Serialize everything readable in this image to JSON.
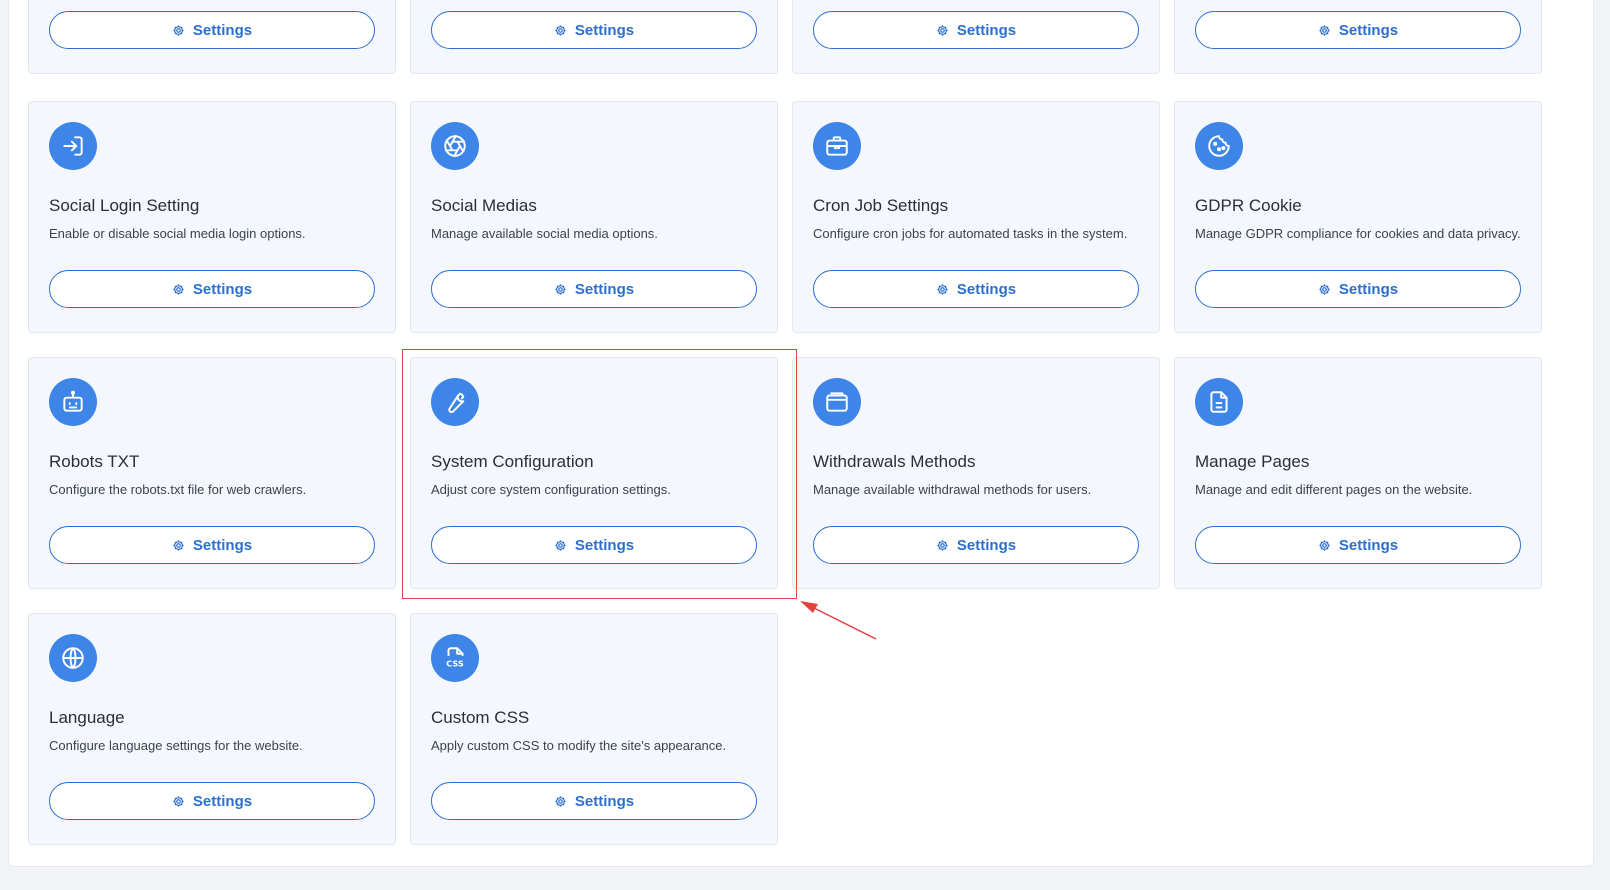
{
  "settings_label": "Settings",
  "colors": {
    "accent": "#3d85e6",
    "button": "#2d6fcf",
    "highlight": "#e5423f"
  },
  "cards": [
    {
      "title": "",
      "description": "",
      "icon": "none"
    },
    {
      "title": "",
      "description": "",
      "icon": "none"
    },
    {
      "title": "",
      "description": "",
      "icon": "none"
    },
    {
      "title": "",
      "description": "",
      "icon": "none"
    },
    {
      "title": "Social Login Setting",
      "description": "Enable or disable social media login options.",
      "icon": "sign-in-icon"
    },
    {
      "title": "Social Medias",
      "description": "Manage available social media options.",
      "icon": "aperture-icon"
    },
    {
      "title": "Cron Job Settings",
      "description": "Configure cron jobs for automated tasks in the system.",
      "icon": "briefcase-icon"
    },
    {
      "title": "GDPR Cookie",
      "description": "Manage GDPR compliance for cookies and data privacy.",
      "icon": "cookie-icon"
    },
    {
      "title": "Robots TXT",
      "description": "Configure the robots.txt file for web crawlers.",
      "icon": "robot-icon"
    },
    {
      "title": "System Configuration",
      "description": "Adjust core system configuration settings.",
      "icon": "wrench-icon"
    },
    {
      "title": "Withdrawals Methods",
      "description": "Manage available withdrawal methods for users.",
      "icon": "wallet-icon"
    },
    {
      "title": "Manage Pages",
      "description": "Manage and edit different pages on the website.",
      "icon": "document-icon"
    },
    {
      "title": "Language",
      "description": "Configure language settings for the website.",
      "icon": "globe-icon"
    },
    {
      "title": "Custom CSS",
      "description": "Apply custom CSS to modify the site's appearance.",
      "icon": "css-file-icon"
    }
  ]
}
